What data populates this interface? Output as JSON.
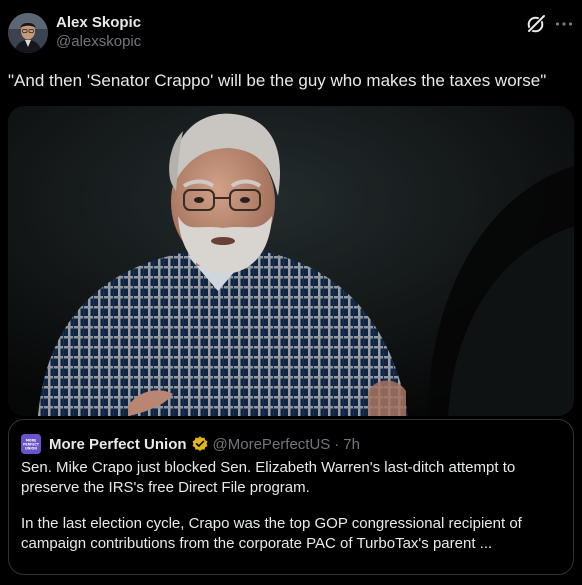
{
  "author": {
    "name": "Alex Skopic",
    "handle": "@alexskopic"
  },
  "tweet_text": "\"And then 'Senator Crappo' will be the guy who makes the taxes worse\"",
  "icons": {
    "grok": "grok-icon",
    "more": "more-horizontal-icon",
    "verified": "gold-verified-badge-icon"
  },
  "colors": {
    "background": "#000000",
    "text_primary": "#e7e9ea",
    "text_secondary": "#71767b",
    "border": "#2f3336",
    "verified_gold": "#e2b719",
    "quote_avatar": "#6b54c8"
  },
  "quote": {
    "account_name": "More Perfect Union",
    "avatar_text": "MORE PERFECT UNION",
    "handle": "@MorePerfectUS",
    "separator": "·",
    "time": "7h",
    "paragraph1_line1": "Sen. Mike Crapo just blocked Sen. Elizabeth Warren's last-ditch attempt to",
    "paragraph1_line2": "preserve the IRS's free Direct File program.",
    "paragraph2_line1": "In the last election cycle, Crapo was the top GOP congressional recipient of",
    "paragraph2_line2": "campaign contributions from the corporate PAC of TurboTax's parent ..."
  }
}
